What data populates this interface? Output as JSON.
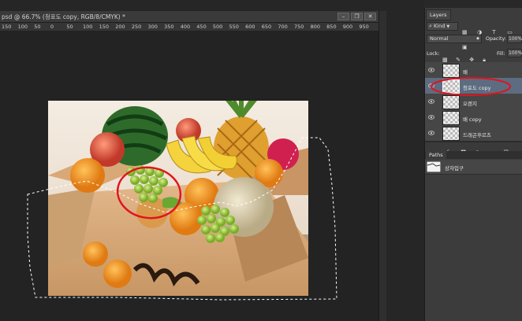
{
  "document": {
    "title": "psd @ 66.7% (청포도 copy, RGB/8/CMYK) *",
    "minimize_label": "–",
    "restore_label": "❐",
    "close_label": "✕",
    "ruler_ticks": [
      "150",
      "100",
      "50",
      "0",
      "50",
      "100",
      "150",
      "200",
      "250",
      "300",
      "350",
      "400",
      "450",
      "500",
      "550",
      "600",
      "650",
      "700",
      "750",
      "800",
      "850",
      "900",
      "950"
    ]
  },
  "layers_panel": {
    "tab_label": "Layers",
    "kind_label": "Kind",
    "blend_mode": "Normal",
    "opacity_label": "Opacity:",
    "opacity_value": "100%",
    "lock_label": "Lock:",
    "fill_label": "Fill:",
    "fill_value": "100%",
    "layers": [
      {
        "name": "배",
        "selected": false
      },
      {
        "name": "청포도 copy",
        "selected": true
      },
      {
        "name": "오렌지",
        "selected": false
      },
      {
        "name": "배 copy",
        "selected": false
      },
      {
        "name": "드래곤후르츠",
        "selected": false
      }
    ]
  },
  "paths_panel": {
    "tab_label": "Paths",
    "paths": [
      {
        "name": "상자입구"
      }
    ]
  },
  "colors": {
    "selection_ellipse": "#e0141e",
    "selected_layer": "#5d6c80",
    "panel_bg": "#3c3c3c"
  }
}
